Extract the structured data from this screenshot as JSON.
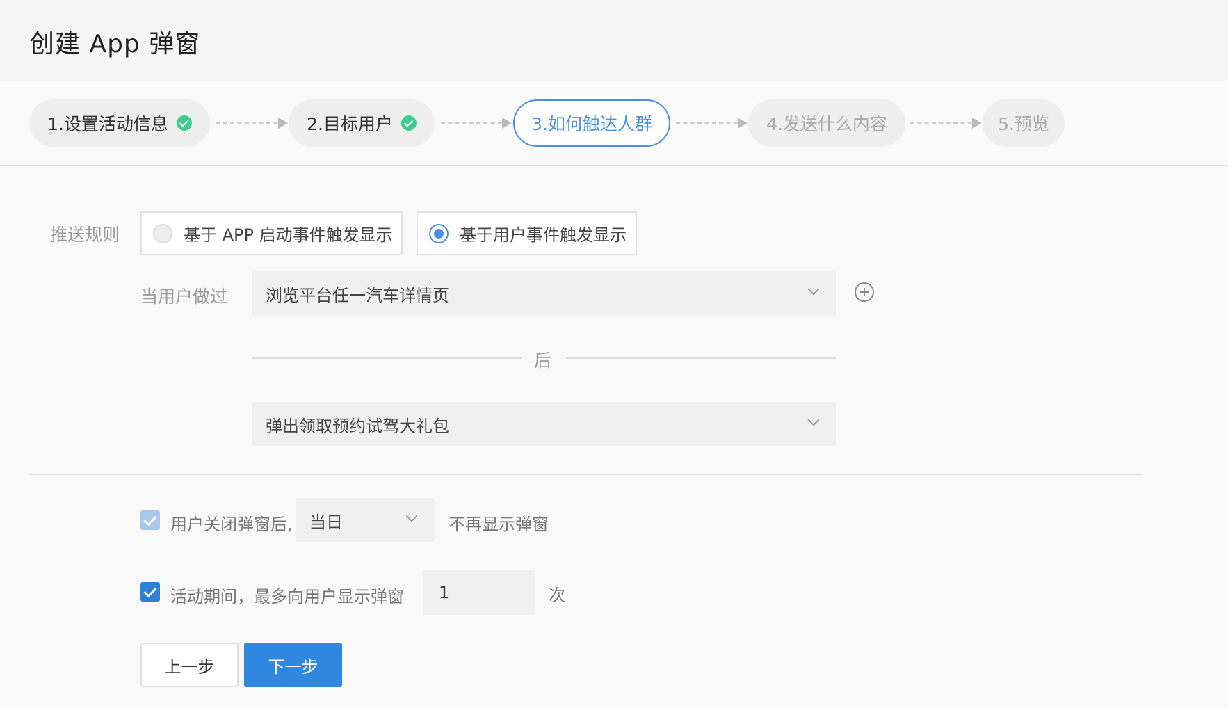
{
  "header": {
    "title": "创建 App 弹窗"
  },
  "steps": [
    {
      "label": "1.设置活动信息",
      "state": "done"
    },
    {
      "label": "2.目标用户",
      "state": "done"
    },
    {
      "label": "3.如何触达人群",
      "state": "active"
    },
    {
      "label": "4.发送什么内容",
      "state": "pending"
    },
    {
      "label": "5.预览",
      "state": "pending"
    }
  ],
  "form": {
    "push_rule_label": "推送规则",
    "push_rule_options": [
      "基于 APP 启动事件触发显示",
      "基于用户事件触发显示"
    ],
    "push_rule_selected": "基于用户事件触发显示",
    "user_did_label": "当用户做过",
    "event_select": "浏览平台任一汽车详情页",
    "after_label": "后",
    "action_select": "弹出领取预约试驾大礼包",
    "close_rule": {
      "prefix": "用户关闭弹窗后,",
      "period": "当日",
      "suffix": "不再显示弹窗",
      "checked": true,
      "disabled": true
    },
    "max_rule": {
      "prefix": "活动期间，最多向用户显示弹窗",
      "count": "1",
      "suffix": "次",
      "checked": true
    }
  },
  "buttons": {
    "prev": "上一步",
    "next": "下一步"
  },
  "colors": {
    "accent": "#2f87e0",
    "success": "#3fcc8f"
  }
}
